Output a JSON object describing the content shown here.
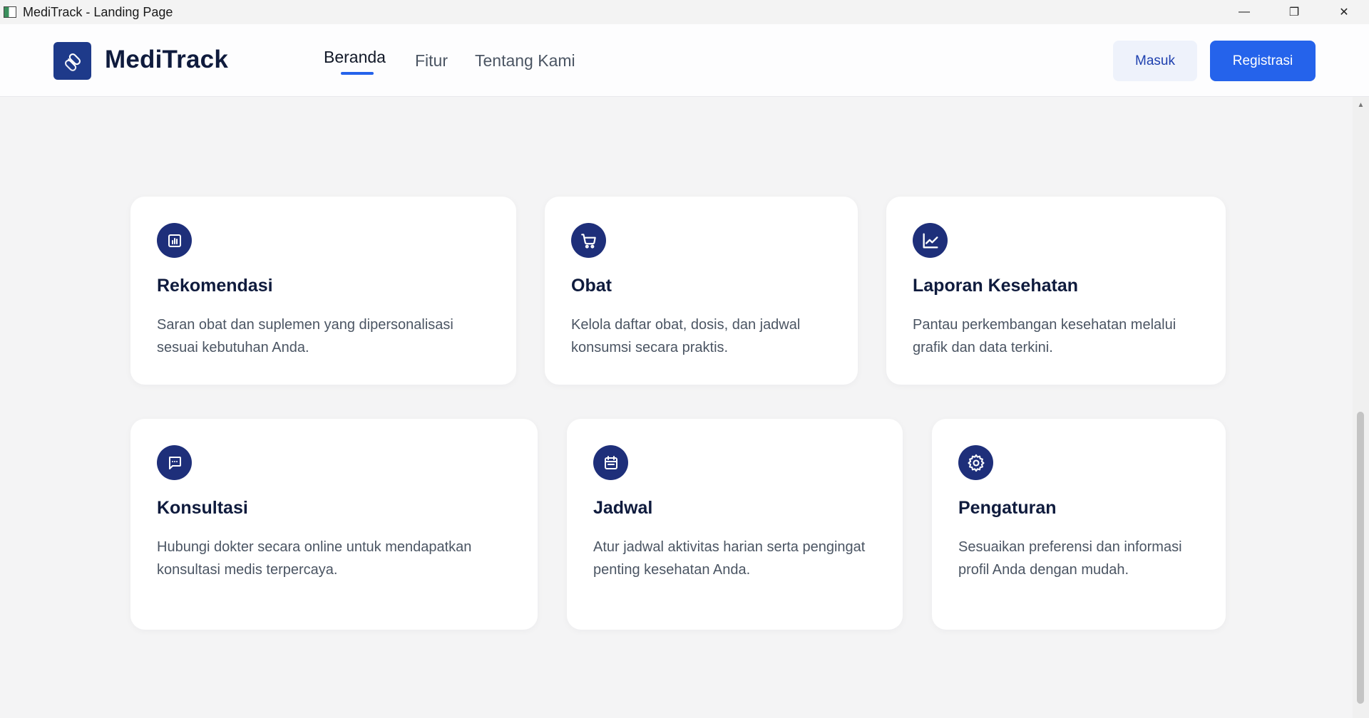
{
  "window": {
    "title": "MediTrack - Landing Page",
    "controls": {
      "minimize": "—",
      "restore": "❐",
      "close": "✕"
    }
  },
  "navbar": {
    "brand": "MediTrack",
    "links": [
      "Beranda",
      "Fitur",
      "Tentang Kami"
    ],
    "active_link": "Beranda",
    "login_label": "Masuk",
    "register_label": "Registrasi"
  },
  "colors": {
    "primary": "#2563eb",
    "navy": "#1e2f7a",
    "brand_text": "#0f1b3d",
    "background": "#f4f4f5"
  },
  "features": [
    {
      "icon": "bar-chart-icon",
      "title": "Rekomendasi",
      "description": "Saran obat dan suplemen yang dipersonalisasi sesuai kebutuhan Anda."
    },
    {
      "icon": "cart-icon",
      "title": "Obat",
      "description": "Kelola daftar obat, dosis, dan jadwal konsumsi secara praktis."
    },
    {
      "icon": "line-chart-icon",
      "title": "Laporan Kesehatan",
      "description": "Pantau perkembangan kesehatan melalui grafik dan data terkini."
    },
    {
      "icon": "chat-icon",
      "title": "Konsultasi",
      "description": "Hubungi dokter secara online untuk mendapatkan konsultasi medis terpercaya."
    },
    {
      "icon": "calendar-icon",
      "title": "Jadwal",
      "description": "Atur jadwal aktivitas harian serta pengingat penting kesehatan Anda."
    },
    {
      "icon": "gear-icon",
      "title": "Pengaturan",
      "description": "Sesuaikan preferensi dan informasi profil Anda dengan mudah."
    }
  ]
}
